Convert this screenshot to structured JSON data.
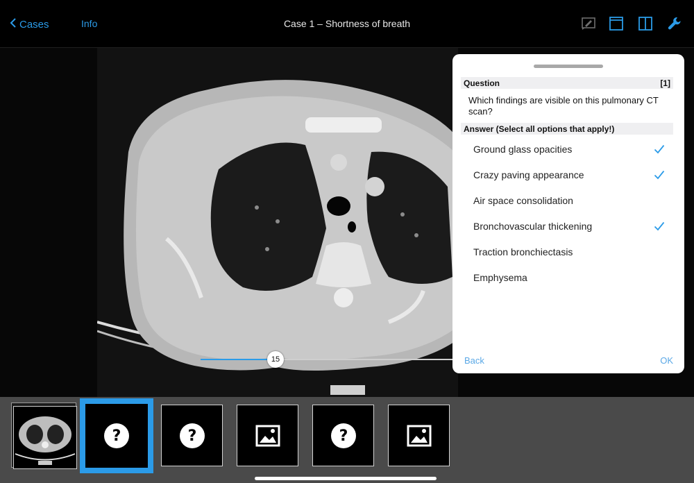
{
  "topbar": {
    "back_label": "Cases",
    "info_label": "Info",
    "title": "Case 1 – Shortness of breath",
    "icons": [
      "annotate-icon",
      "single-view-icon",
      "split-view-icon",
      "wrench-icon"
    ]
  },
  "viewer": {
    "slice_number": "15",
    "slice_progress": 0.3
  },
  "question_panel": {
    "question_header": "Question",
    "question_index": "[1]",
    "question_text": "Which findings are visible on this pulmonary CT scan?",
    "answer_header": "Answer (Select all options that apply!)",
    "options": [
      {
        "label": "Ground glass opacities",
        "checked": true
      },
      {
        "label": "Crazy paving appearance",
        "checked": true
      },
      {
        "label": "Air space consolidation",
        "checked": false
      },
      {
        "label": "Bronchovascular thickening",
        "checked": true
      },
      {
        "label": "Traction bronchiectasis",
        "checked": false
      },
      {
        "label": "Emphysema",
        "checked": false
      }
    ],
    "back_label": "Back",
    "ok_label": "OK"
  },
  "filmstrip": {
    "items": [
      {
        "type": "question",
        "icon": "question-icon",
        "selected": true
      },
      {
        "type": "question",
        "icon": "question-icon",
        "selected": false
      },
      {
        "type": "image",
        "icon": "image-icon",
        "selected": false
      },
      {
        "type": "question",
        "icon": "question-icon",
        "selected": false
      },
      {
        "type": "image",
        "icon": "image-icon",
        "selected": false
      }
    ]
  },
  "colors": {
    "accent": "#2b9be8",
    "panel_bg": "#ffffff",
    "header_bg": "#efeff1",
    "filmstrip_bg": "#4a4a4a"
  }
}
